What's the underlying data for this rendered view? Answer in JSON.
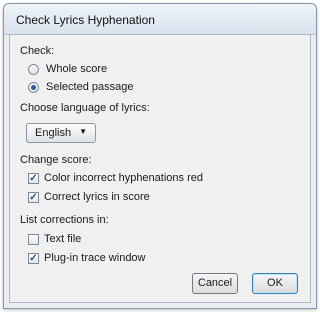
{
  "window": {
    "title": "Check Lyrics Hyphenation"
  },
  "check_section": {
    "label": "Check:",
    "options": [
      {
        "label": "Whole score",
        "selected": false
      },
      {
        "label": "Selected passage",
        "selected": true
      }
    ]
  },
  "language": {
    "label": "Choose language of lyrics:",
    "selected": "English",
    "options": [
      "English"
    ]
  },
  "change_score": {
    "label": "Change score:",
    "options": [
      {
        "label": "Color incorrect hyphenations red",
        "checked": true
      },
      {
        "label": "Correct lyrics in score",
        "checked": true
      }
    ]
  },
  "list_corrections": {
    "label": "List corrections in:",
    "options": [
      {
        "label": "Text file",
        "checked": false
      },
      {
        "label": "Plug-in trace window",
        "checked": true
      }
    ]
  },
  "buttons": {
    "cancel": "Cancel",
    "ok": "OK"
  },
  "icons": {
    "dropdown": "chevron-down-icon",
    "check": "checkmark-icon"
  }
}
